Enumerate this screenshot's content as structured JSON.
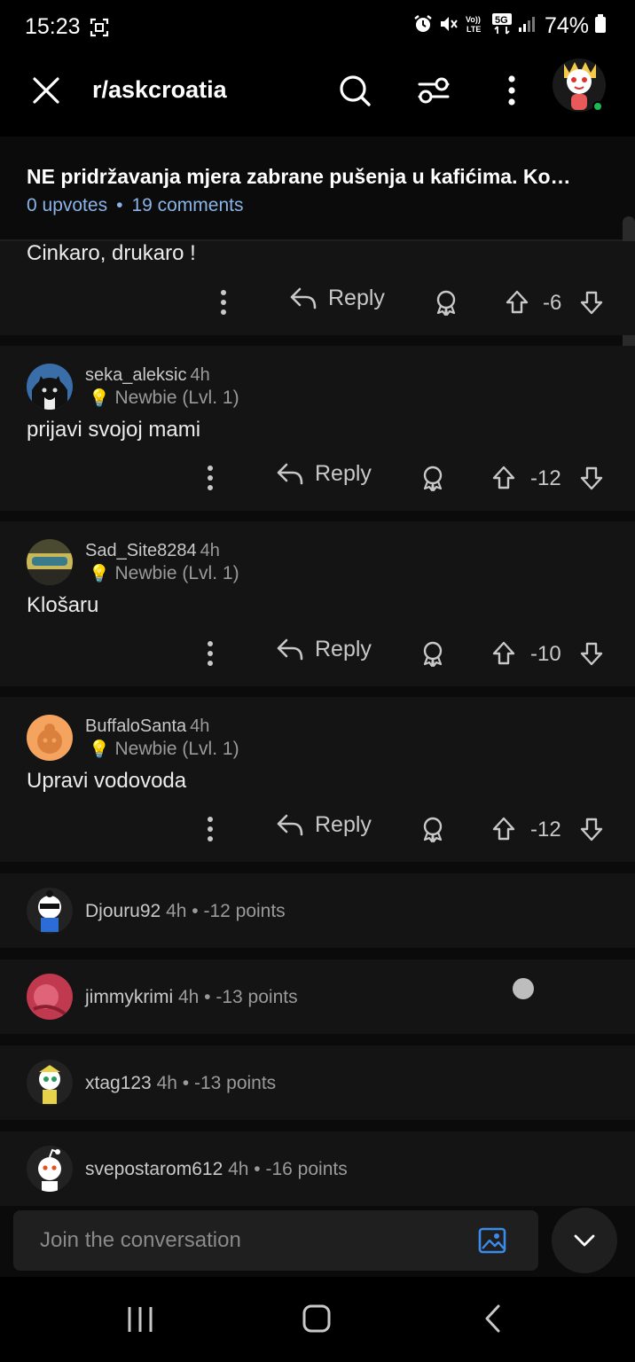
{
  "status_bar": {
    "time": "15:23",
    "battery": "74%",
    "icons": [
      "screenshot-icon",
      "alarm-icon",
      "mute-icon",
      "volte-icon",
      "5g-icon",
      "signal-icon",
      "battery-icon"
    ]
  },
  "top_bar": {
    "subreddit": "r/askcroatia",
    "icons": [
      "close-icon",
      "search-icon",
      "filter-icon",
      "more-vert-icon",
      "avatar"
    ]
  },
  "post": {
    "title": "NE pridržavanja mjera zabrane pušenja u kafićima. Ko…",
    "upvotes": "0 upvotes",
    "separator": "•",
    "comments": "19 comments"
  },
  "reply_label": "Reply",
  "comments": [
    {
      "body": "Cinkaro, drukaro !",
      "score": "-6"
    },
    {
      "username": "seka_aleksic",
      "age": "4h",
      "flair": "Newbie (Lvl. 1)",
      "body": "prijavi svojoj mami",
      "score": "-12"
    },
    {
      "username": "Sad_Site8284",
      "age": "4h",
      "flair": "Newbie (Lvl. 1)",
      "body": "Klošaru",
      "score": "-10"
    },
    {
      "username": "BuffaloSanta",
      "age": "4h",
      "flair": "Newbie (Lvl. 1)",
      "body": "Upravi vodovoda",
      "score": "-12"
    }
  ],
  "collapsed_comments": [
    {
      "username": "Djouru92",
      "meta": "4h • -12 points"
    },
    {
      "username": "jimmykrimi",
      "meta": "4h • -13 points"
    },
    {
      "username": "xtag123",
      "meta": "4h • -13 points"
    },
    {
      "username": "svepostarom612",
      "meta": "4h • -16 points"
    }
  ],
  "composer": {
    "placeholder": "Join the conversation"
  },
  "colors": {
    "background": "#0b0b0b",
    "card": "#141414",
    "link_blue": "#8ab4e8",
    "online_green": "#1db954",
    "image_icon_blue": "#3b8beb"
  }
}
